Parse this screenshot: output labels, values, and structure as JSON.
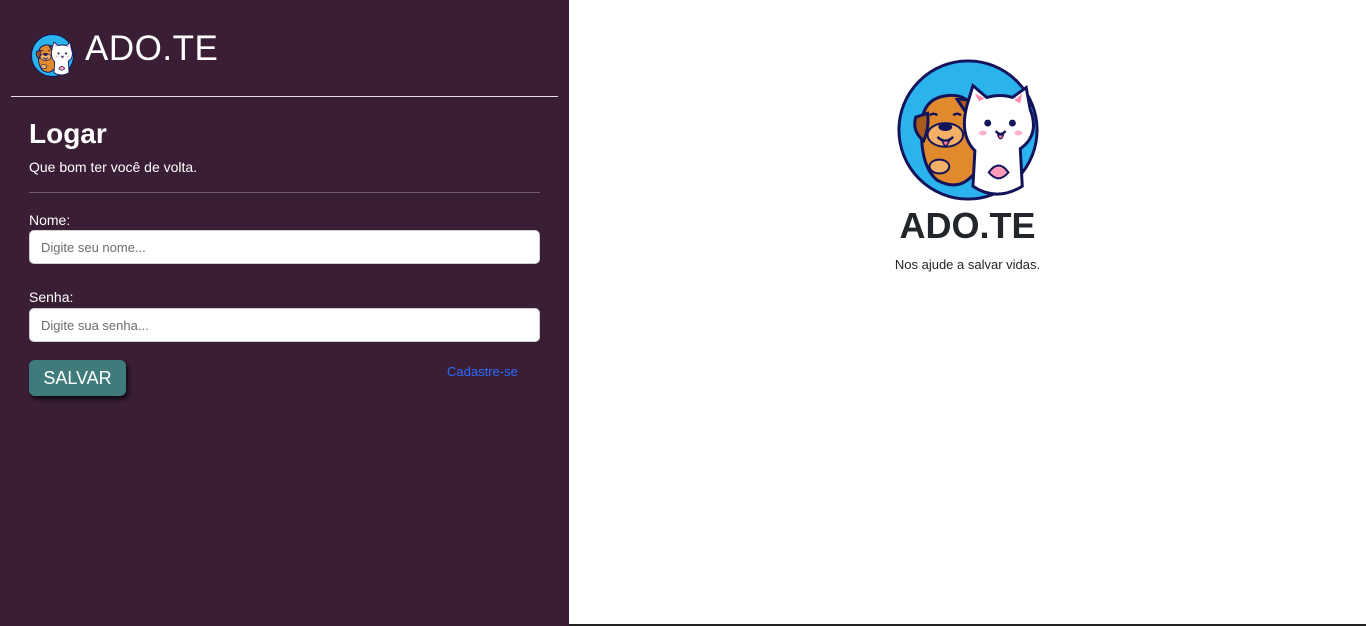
{
  "brand": {
    "name": "ADO.TE",
    "logo_icon": "dog-and-cat-logo-icon"
  },
  "login": {
    "title": "Logar",
    "subtitle": "Que bom ter você de volta.",
    "name_label": "Nome:",
    "name_value": "",
    "name_placeholder": "Digite seu nome...",
    "password_label": "Senha:",
    "password_value": "",
    "password_placeholder": "Digite sua senha...",
    "save_label": "SALVAR",
    "signup_label": "Cadastre-se"
  },
  "hero": {
    "title": "ADO.TE",
    "tagline": "Nos ajude a salvar vidas.",
    "logo_icon": "dog-and-cat-logo-icon"
  },
  "colors": {
    "sidebar_bg": "#3a1e35",
    "button_bg": "#3f7b7c",
    "link": "#2a6dff",
    "logo_ring": "#2ab3ec"
  }
}
